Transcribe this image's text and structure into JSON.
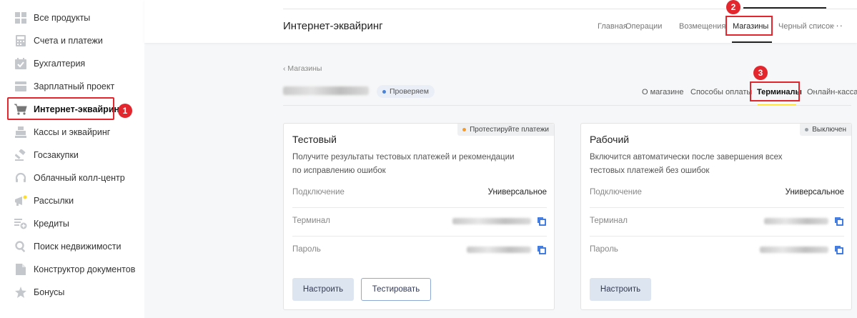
{
  "sidebar": {
    "items": [
      {
        "label": "Все продукты",
        "icon": "grid-icon"
      },
      {
        "label": "Счета и платежи",
        "icon": "calculator-icon"
      },
      {
        "label": "Бухгалтерия",
        "icon": "calendar-check-icon"
      },
      {
        "label": "Зарплатный проект",
        "icon": "wallet-icon"
      },
      {
        "label": "Интернет-эквайринг",
        "icon": "cart-icon"
      },
      {
        "label": "Кассы и эквайринг",
        "icon": "cash-register-icon"
      },
      {
        "label": "Госзакупки",
        "icon": "gavel-icon"
      },
      {
        "label": "Облачный колл-центр",
        "icon": "headset-icon"
      },
      {
        "label": "Рассылки",
        "icon": "megaphone-icon"
      },
      {
        "label": "Кредиты",
        "icon": "credit-plus-icon"
      },
      {
        "label": "Поиск недвижимости",
        "icon": "search-icon"
      },
      {
        "label": "Конструктор документов",
        "icon": "document-icon"
      },
      {
        "label": "Бонусы",
        "icon": "star-icon"
      }
    ],
    "active_index": 4
  },
  "step_badges": [
    "1",
    "2",
    "3"
  ],
  "header": {
    "title": "Интернет-эквайринг",
    "nav": [
      "Главная",
      "Операции",
      "Возмещения",
      "Магазины",
      "Черный список"
    ],
    "active_nav": "Магазины",
    "more": "···"
  },
  "shop": {
    "breadcrumb": "Магазины",
    "breadcrumb_icon": "chevron-left-icon",
    "status": "Проверяем",
    "tabs": [
      "О магазине",
      "Способы оплаты",
      "Терминалы",
      "Онлайн-касса"
    ],
    "active_tab": "Терминалы"
  },
  "cards": {
    "test": {
      "tag": "Протестируйте платежи",
      "tag_color": "#f59b2e",
      "title": "Тестовый",
      "desc": "Получите результаты тестовых платежей и рекомендации по исправлению ошибок",
      "connection_label": "Подключение",
      "connection_value": "Универсальное",
      "terminal_label": "Терминал",
      "password_label": "Пароль",
      "btn_configure": "Настроить",
      "btn_test": "Тестировать"
    },
    "work": {
      "tag": "Выключен",
      "tag_color": "#9aa0a6",
      "title": "Рабочий",
      "desc": "Включится автоматически после завершения всех тестовых платежей без ошибок",
      "connection_label": "Подключение",
      "connection_value": "Универсальное",
      "terminal_label": "Терминал",
      "password_label": "Пароль",
      "btn_configure": "Настроить"
    }
  },
  "colors": {
    "highlight": "#e3262d",
    "accent_yellow": "#ffdd2d",
    "copy_icon": "#2f6fde"
  }
}
